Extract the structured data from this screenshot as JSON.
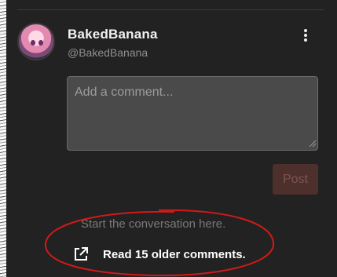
{
  "user": {
    "name": "BakedBanana",
    "handle": "@BakedBanana",
    "avatar_icon": "anime-girl-avatar"
  },
  "menu": {
    "icon": "more-vertical-icon"
  },
  "comment_input": {
    "placeholder": "Add a comment...",
    "value": ""
  },
  "post_button": {
    "label": "Post"
  },
  "thread": {
    "empty_message": "Start the conversation here.",
    "older_link_label": "Read 15 older comments.",
    "older_link_icon": "external-link-icon"
  },
  "colors": {
    "background": "#222222",
    "input_bg": "#4a4a4a",
    "post_button_bg": "#4d2f2c",
    "annotation": "#d11a1a"
  }
}
